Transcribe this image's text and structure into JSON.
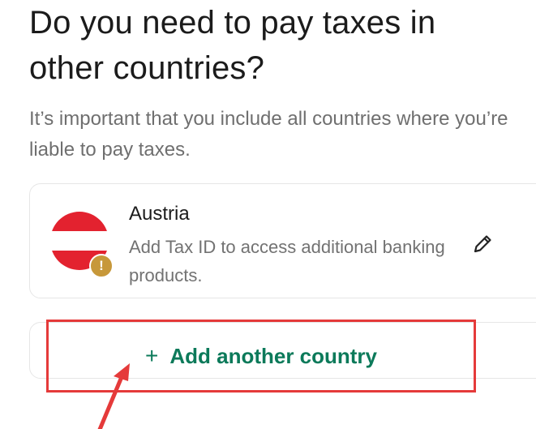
{
  "page": {
    "title": "Do you need to pay taxes in other countries?",
    "subtitle": "It’s important that you include all countries where you’re liable to pay taxes."
  },
  "country_card": {
    "name": "Austria",
    "note": "Add Tax ID to access additional banking products.",
    "flag_icon": "austria-flag-icon",
    "warning_icon": "warning-badge-icon",
    "warning_glyph": "!",
    "edit_icon": "pencil-icon"
  },
  "add_country": {
    "plus_glyph": "+",
    "label": "Add another country",
    "plus_icon": "plus-icon"
  },
  "colors": {
    "accent_green": "#0c7a5a",
    "highlight_red": "#e53a3a",
    "flag_red": "#e3222f",
    "warning_gold": "#c7983a"
  }
}
